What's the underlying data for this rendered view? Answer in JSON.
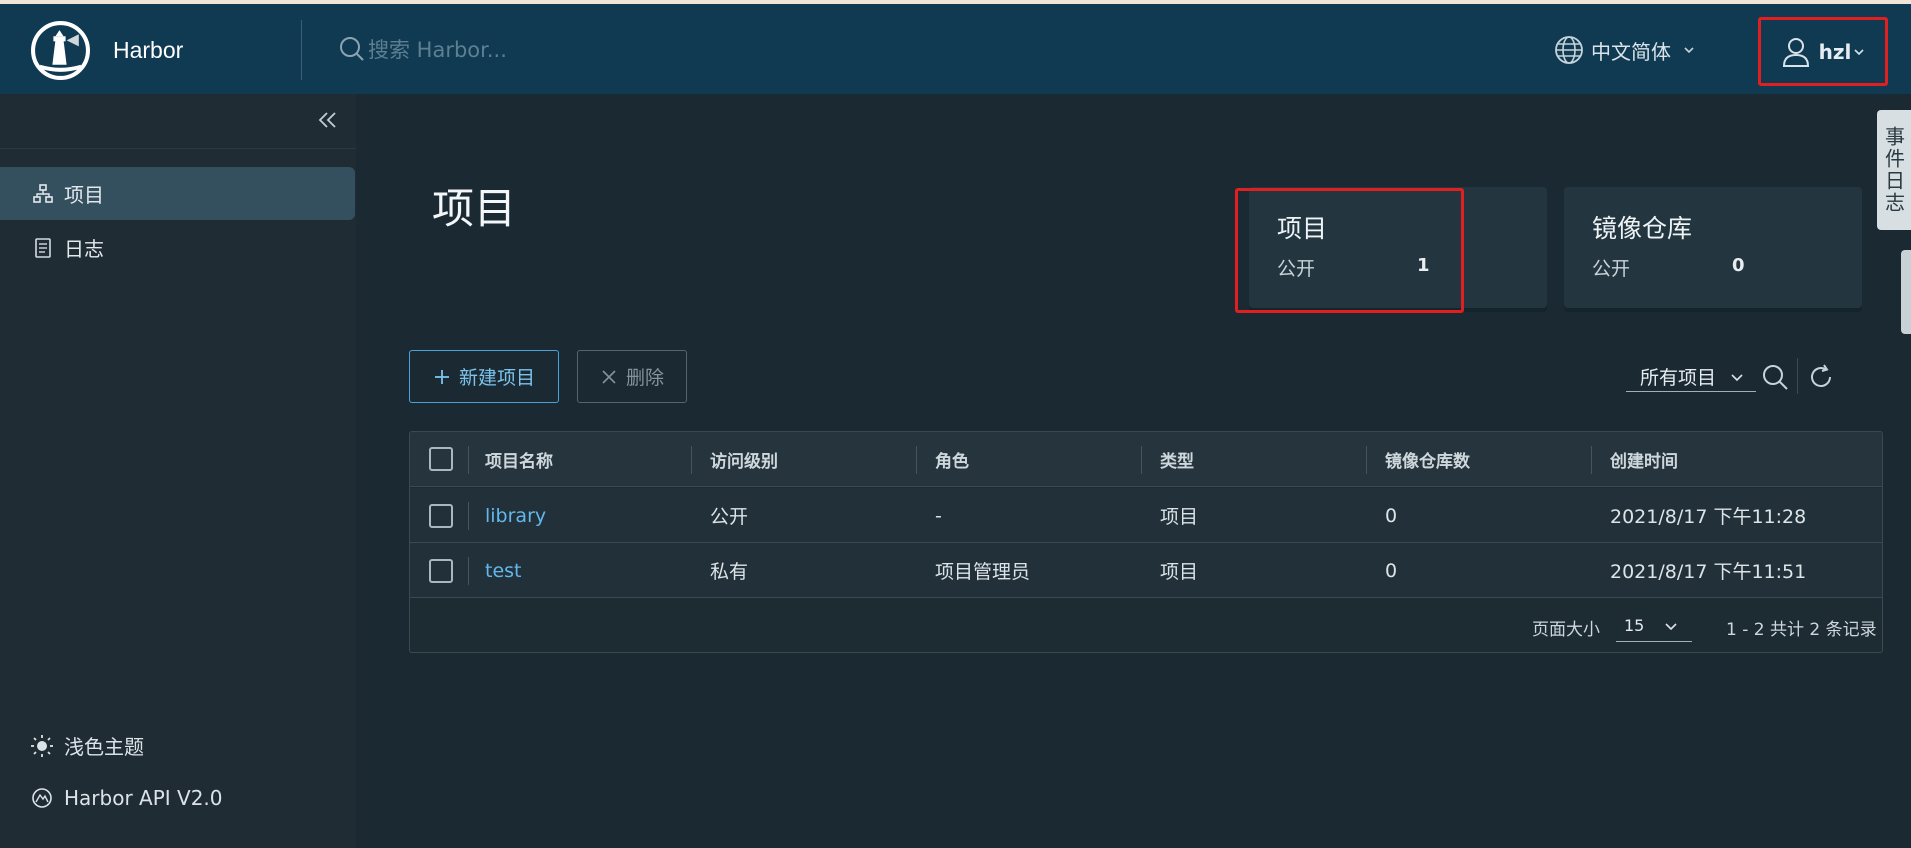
{
  "header": {
    "brand_name": "Harbor",
    "search_placeholder": "搜索 Harbor...",
    "language": "中文简体",
    "username": "hzl"
  },
  "sidebar": {
    "items": [
      {
        "label": "项目",
        "icon": "projects-icon",
        "active": true
      },
      {
        "label": "日志",
        "icon": "logs-icon",
        "active": false
      }
    ],
    "footer": [
      {
        "label": "浅色主题",
        "icon": "sun-icon"
      },
      {
        "label": "Harbor API V2.0",
        "icon": "api-icon"
      }
    ]
  },
  "main": {
    "title": "项目",
    "cards": [
      {
        "title": "项目",
        "label": "公开",
        "value": "1"
      },
      {
        "title": "镜像仓库",
        "label": "公开",
        "value": "0"
      }
    ],
    "side_tab": "事件日志",
    "toolbar": {
      "new_label": "新建项目",
      "delete_label": "删除",
      "filter_value": "所有项目"
    },
    "table": {
      "columns": [
        "项目名称",
        "访问级别",
        "角色",
        "类型",
        "镜像仓库数",
        "创建时间"
      ],
      "rows": [
        {
          "name": "library",
          "access": "公开",
          "role": "-",
          "type": "项目",
          "repos": "0",
          "created": "2021/8/17 下午11:28"
        },
        {
          "name": "test",
          "access": "私有",
          "role": "项目管理员",
          "type": "项目",
          "repos": "0",
          "created": "2021/8/17 下午11:51"
        }
      ],
      "page_size_label": "页面大小",
      "page_size": "15",
      "count_text": "1 - 2 共计 2 条记录"
    }
  },
  "colors": {
    "header_bg": "#0f3a52",
    "sidebar_bg": "#1f2c33",
    "main_bg": "#1b2a32",
    "accent": "#62b8ec",
    "highlight": "#e02020"
  }
}
